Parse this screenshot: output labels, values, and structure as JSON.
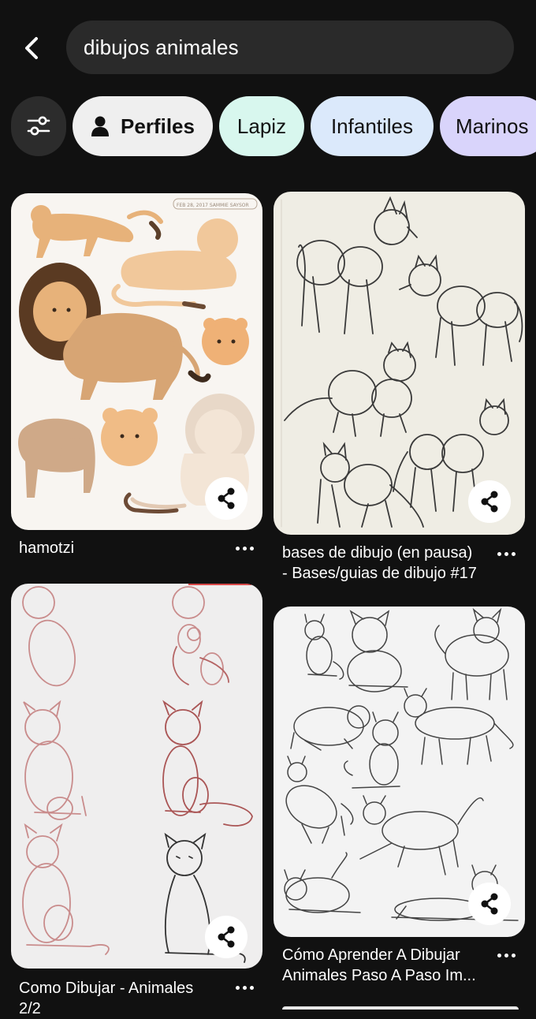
{
  "search": {
    "query": "dibujos animales"
  },
  "chips": {
    "profiles_label": "Perfiles",
    "items": [
      "Lapiz",
      "Infantiles",
      "Marinos"
    ]
  },
  "pins": [
    {
      "title": "hamotzi",
      "image": "lions-illustration",
      "watermark": "FEB 28, 2017 SAMMIE SAYSOR"
    },
    {
      "title_lines": [
        "bases de dibujo (en pausa)",
        "- Bases/guias de dibujo #17"
      ],
      "image": "wolf-sketches"
    },
    {
      "title_lines": [
        "Como Dibujar - Animales",
        "2/2"
      ],
      "image": "cat-step-guide"
    },
    {
      "title_lines": [
        "Cómo Aprender A Dibujar",
        "Animales Paso A Paso Im..."
      ],
      "image": "cat-sketches"
    }
  ],
  "icons": {
    "back": "back-arrow-icon",
    "filter": "sliders-icon",
    "profile": "person-icon",
    "share": "share-icon",
    "more": "more-dots-icon"
  },
  "colors": {
    "background": "#111111",
    "search_field": "#2a2a2a",
    "chip_lapiz": "#d8f7ee",
    "chip_infantiles": "#dbe9fb",
    "chip_marinos": "#d9d4fb"
  }
}
